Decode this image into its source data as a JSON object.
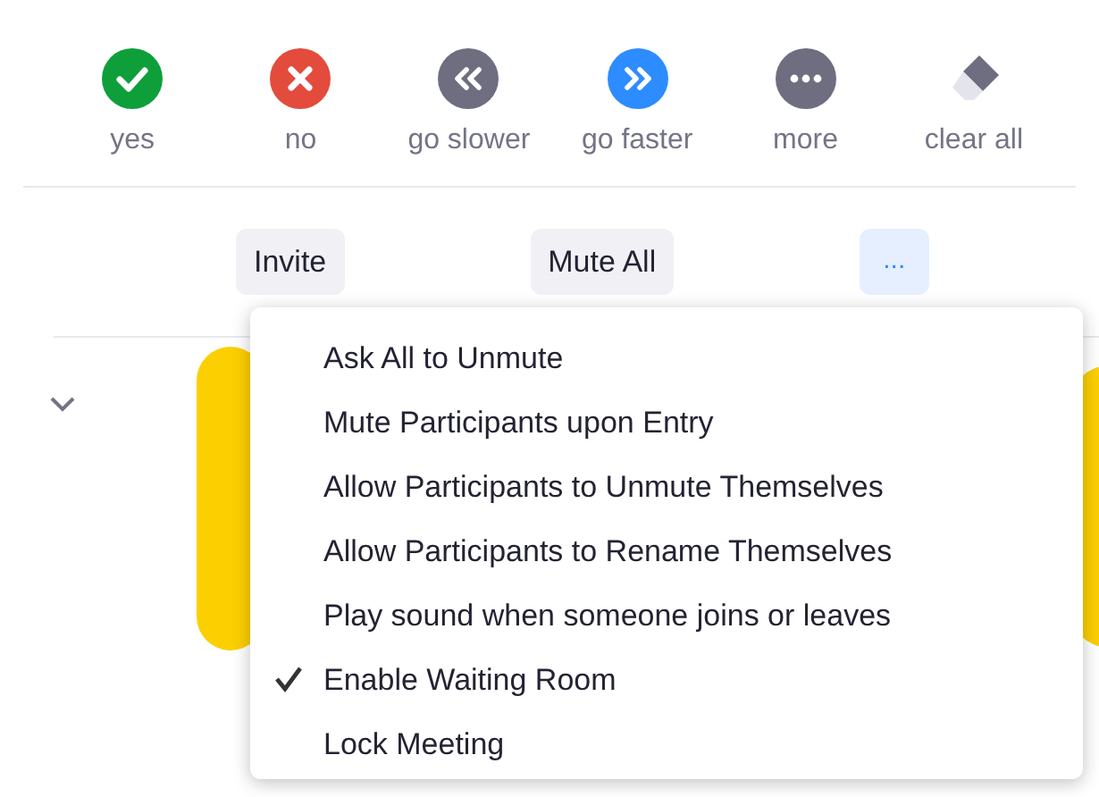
{
  "reactions": [
    {
      "label": "yes"
    },
    {
      "label": "no"
    },
    {
      "label": "go slower"
    },
    {
      "label": "go faster"
    },
    {
      "label": "more"
    },
    {
      "label": "clear all"
    }
  ],
  "buttons": [
    {
      "label": "Invite",
      "selected": false
    },
    {
      "label": "Mute All",
      "selected": false
    },
    {
      "label": "...",
      "selected": true
    }
  ],
  "menu": [
    {
      "label": "Ask All to Unmute",
      "checked": false
    },
    {
      "label": "Mute Participants upon Entry",
      "checked": false
    },
    {
      "label": "Allow Participants to Unmute Themselves",
      "checked": false
    },
    {
      "label": "Allow Participants to Rename Themselves",
      "checked": false
    },
    {
      "label": "Play sound when someone joins or leaves",
      "checked": false
    },
    {
      "label": "Enable Waiting Room",
      "checked": true
    },
    {
      "label": "Lock Meeting",
      "checked": false
    }
  ]
}
